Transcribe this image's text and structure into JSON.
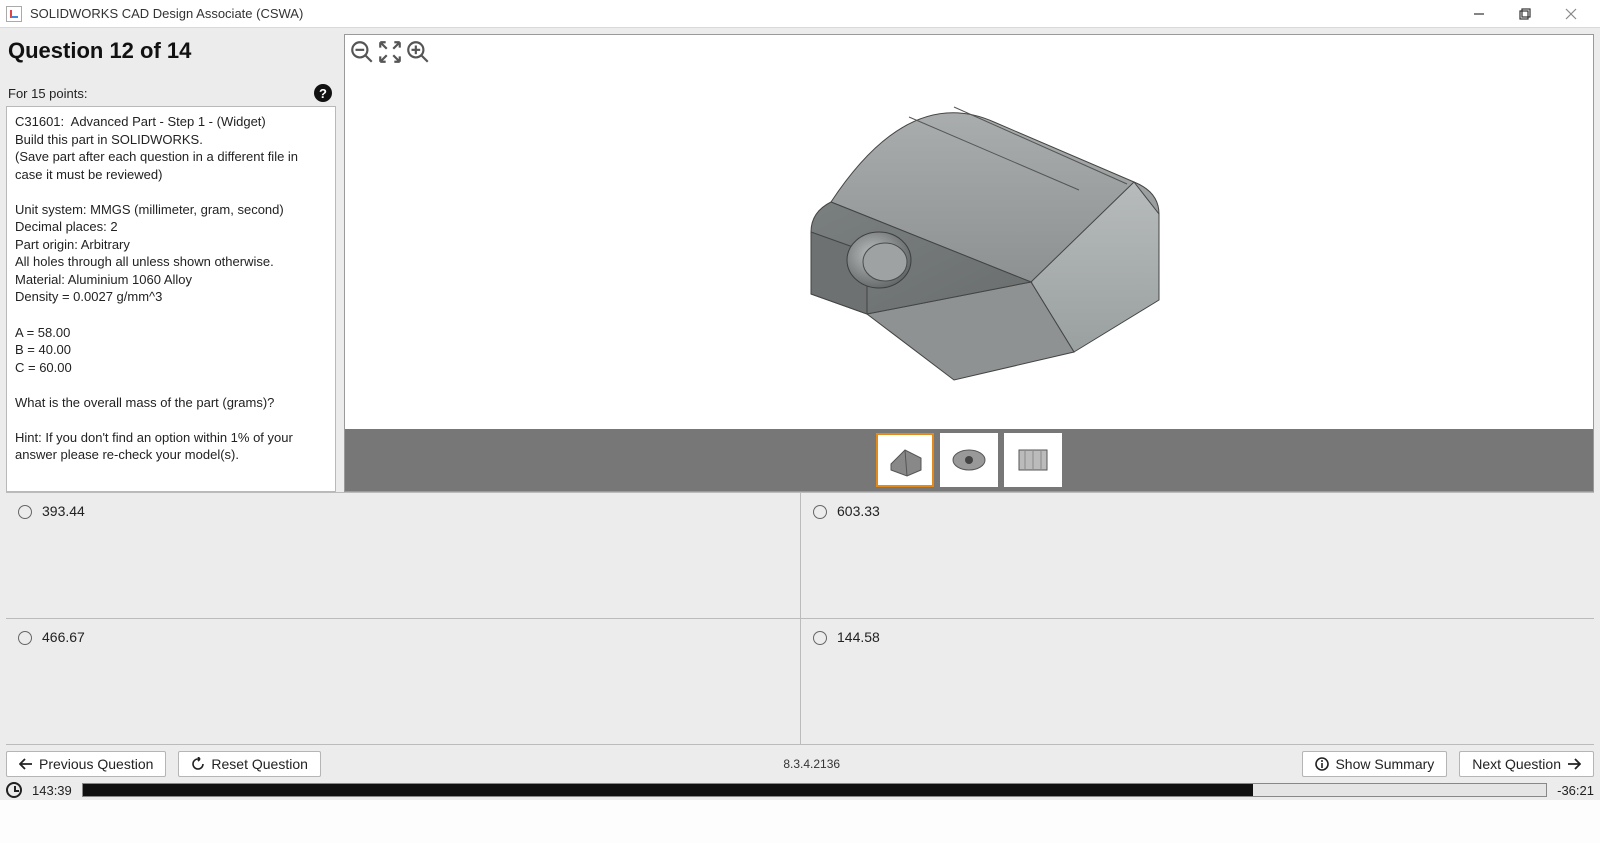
{
  "window": {
    "title": "SOLIDWORKS CAD Design Associate (CSWA)"
  },
  "question": {
    "heading": "Question 12 of 14",
    "points_label": "For 15 points:",
    "body": "C31601:  Advanced Part - Step 1 - (Widget)\nBuild this part in SOLIDWORKS.\n(Save part after each question in a different file in case it must be reviewed)\n\nUnit system: MMGS (millimeter, gram, second)\nDecimal places: 2\nPart origin: Arbitrary\nAll holes through all unless shown otherwise.\nMaterial: Aluminium 1060 Alloy\nDensity = 0.0027 g/mm^3\n\nA = 58.00\nB = 40.00\nC = 60.00\n\nWhat is the overall mass of the part (grams)?\n\nHint: If you don't find an option within 1% of your answer please re-check your model(s)."
  },
  "thumbs": {
    "selected_index": 0,
    "names": [
      "iso-view-thumb",
      "top-view-thumb",
      "side-view-thumb"
    ]
  },
  "answers": [
    {
      "label": "393.44"
    },
    {
      "label": "603.33"
    },
    {
      "label": "466.67"
    },
    {
      "label": "144.58"
    }
  ],
  "footer": {
    "prev": "Previous Question",
    "reset": "Reset Question",
    "summary": "Show Summary",
    "next": "Next Question",
    "build": "8.3.4.2136",
    "time_elapsed": "143:39",
    "time_remaining": "-36:21",
    "progress_percent": 80
  }
}
